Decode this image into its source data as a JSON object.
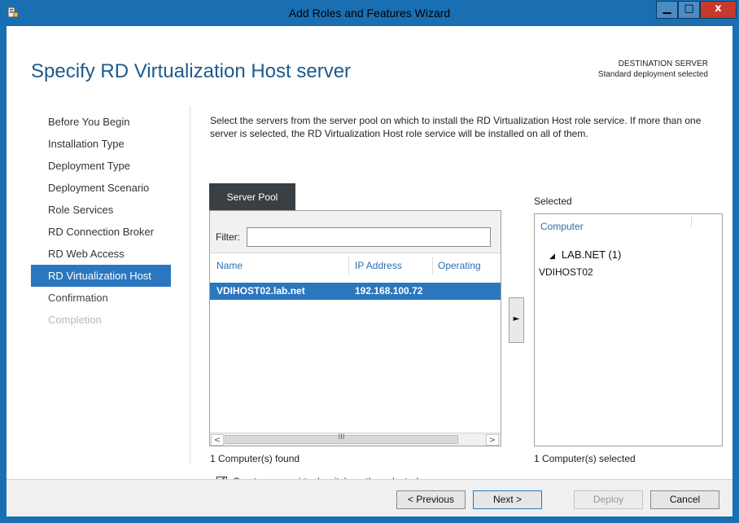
{
  "window": {
    "title": "Add Roles and Features Wizard",
    "minimize_glyph": "▁",
    "maximize_glyph": "□",
    "close_glyph": "x"
  },
  "header": {
    "page_title": "Specify RD Virtualization Host server",
    "destination_label": "DESTINATION SERVER",
    "destination_value": "Standard deployment selected"
  },
  "nav": {
    "items": [
      {
        "label": "Before You Begin",
        "state": "done"
      },
      {
        "label": "Installation Type",
        "state": "done"
      },
      {
        "label": "Deployment Type",
        "state": "done"
      },
      {
        "label": "Deployment Scenario",
        "state": "done"
      },
      {
        "label": "Role Services",
        "state": "done"
      },
      {
        "label": "RD Connection Broker",
        "state": "done"
      },
      {
        "label": "RD Web Access",
        "state": "done"
      },
      {
        "label": "RD Virtualization Host",
        "state": "active"
      },
      {
        "label": "Confirmation",
        "state": "pending"
      },
      {
        "label": "Completion",
        "state": "disabled"
      }
    ]
  },
  "main": {
    "description": "Select the servers from the server pool on which to install the RD Virtualization Host role service. If more than one server is selected, the RD Virtualization Host role service will be installed on all of them.",
    "server_pool": {
      "tab_label": "Server Pool",
      "filter_label": "Filter:",
      "filter_value": "",
      "columns": {
        "name": "Name",
        "ip": "IP Address",
        "os": "Operating"
      },
      "rows": [
        {
          "name": "VDIHOST02.lab.net",
          "ip": "192.168.100.72",
          "os": "",
          "selected": true
        }
      ],
      "scroll_left": "<",
      "scroll_right": ">",
      "scroll_grip": "III",
      "count_text": "1 Computer(s) found"
    },
    "add_button_glyph": "►",
    "selected": {
      "label": "Selected",
      "column": "Computer",
      "group_glyph": "◢",
      "group": "LAB.NET (1)",
      "items": [
        "VDIHOST02"
      ],
      "count_text": "1 Computer(s) selected"
    },
    "checkbox": {
      "checked": true,
      "glyph": "✔",
      "label": "Create a new virtual switch on the selected servers"
    }
  },
  "footer": {
    "previous": "< Previous",
    "next": "Next >",
    "deploy": "Deploy",
    "cancel": "Cancel"
  }
}
